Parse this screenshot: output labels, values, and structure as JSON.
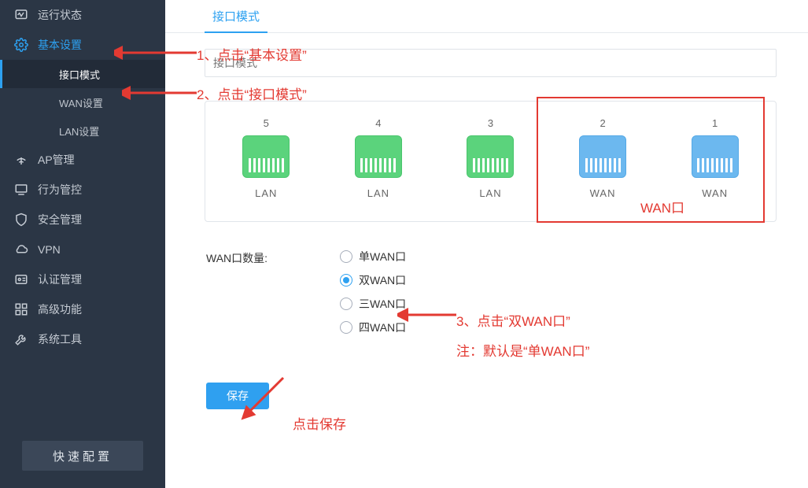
{
  "sidebar": {
    "items": [
      {
        "label": "运行状态"
      },
      {
        "label": "基本设置"
      },
      {
        "label": "AP管理"
      },
      {
        "label": "行为管控"
      },
      {
        "label": "安全管理"
      },
      {
        "label": "VPN"
      },
      {
        "label": "认证管理"
      },
      {
        "label": "高级功能"
      },
      {
        "label": "系统工具"
      }
    ],
    "sub_items": [
      {
        "label": "接口模式"
      },
      {
        "label": "WAN设置"
      },
      {
        "label": "LAN设置"
      }
    ],
    "quick_config": "快速配置"
  },
  "tabs": {
    "active": "接口模式"
  },
  "search": {
    "placeholder": "接口模式"
  },
  "ports": [
    {
      "num": "5",
      "type": "LAN"
    },
    {
      "num": "4",
      "type": "LAN"
    },
    {
      "num": "3",
      "type": "LAN"
    },
    {
      "num": "2",
      "type": "WAN"
    },
    {
      "num": "1",
      "type": "WAN"
    }
  ],
  "wan_box_label": "WAN口",
  "radio": {
    "label": "WAN口数量:",
    "options": [
      "单WAN口",
      "双WAN口",
      "三WAN口",
      "四WAN口"
    ],
    "selected_index": 1
  },
  "save_label": "保存",
  "annotations": {
    "a1": "1、点击“基本设置”",
    "a2": "2、点击“接口模式”",
    "a3": "3、点击“双WAN口”",
    "a3_note": "注：默认是“单WAN口”",
    "a_save": "点击保存"
  }
}
